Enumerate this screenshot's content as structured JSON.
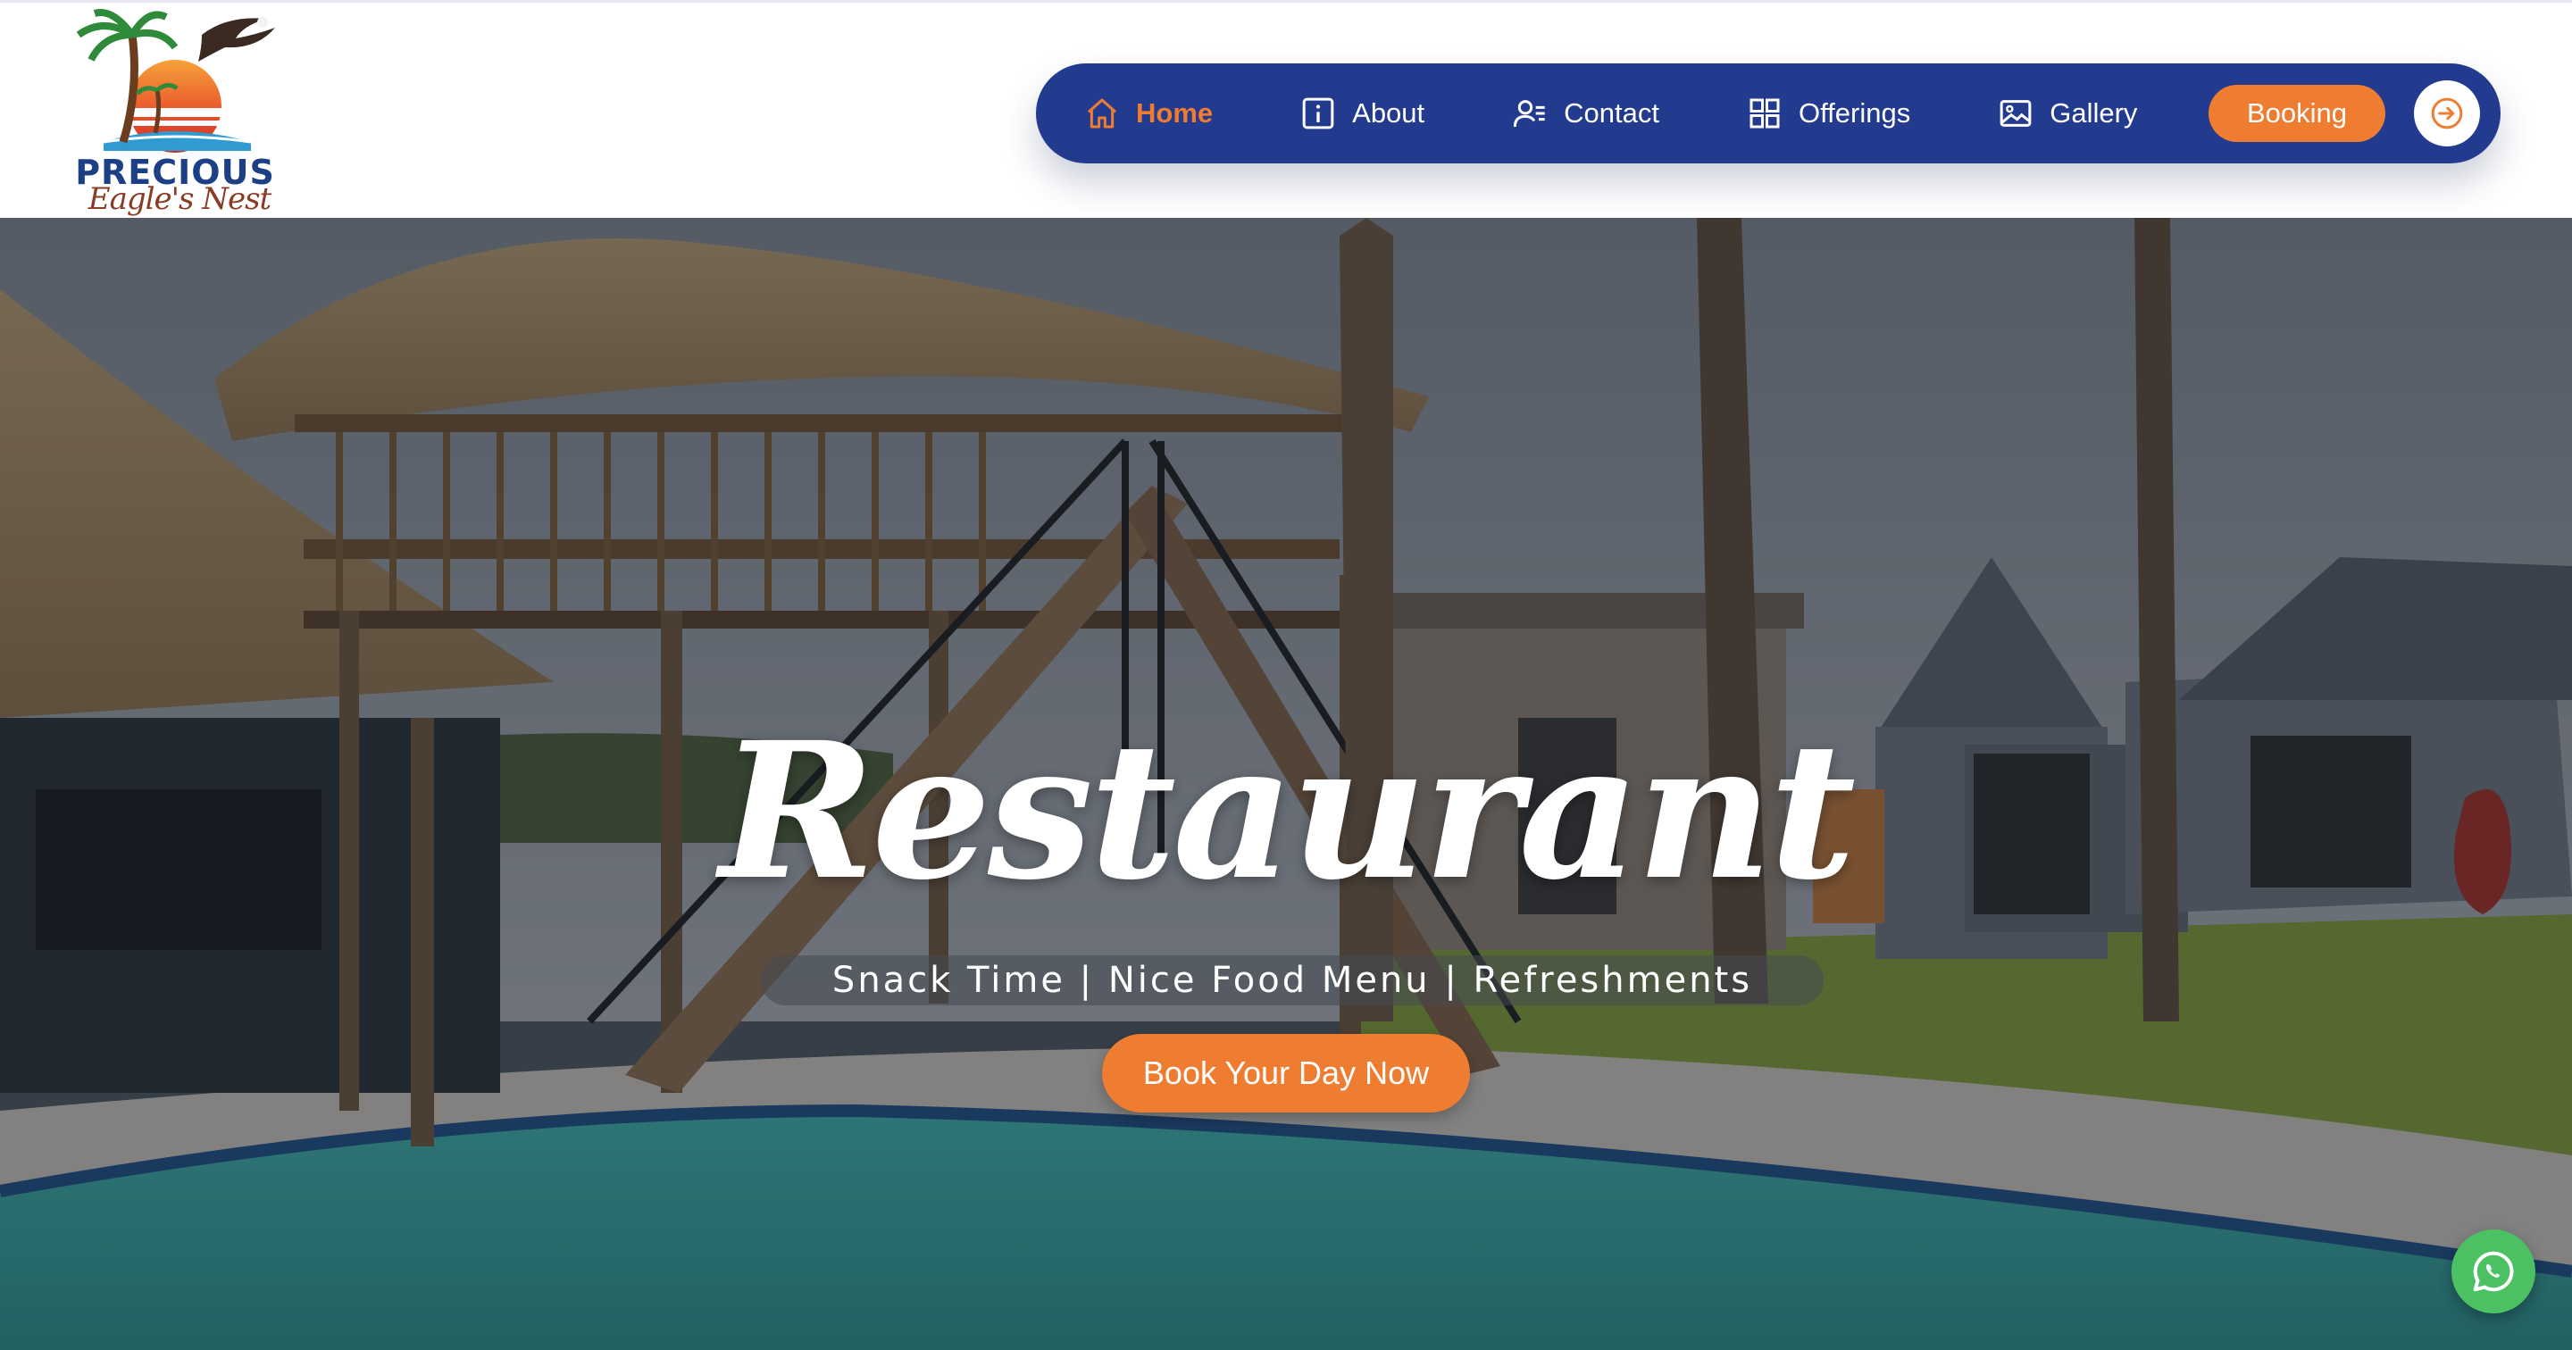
{
  "brand": {
    "name": "PRECIOUS",
    "tagline": "Eagle's Nest",
    "logo_icon": "palm-sunset-eagle-logo"
  },
  "nav": {
    "items": [
      {
        "label": "Home",
        "icon": "home-icon",
        "active": true
      },
      {
        "label": "About",
        "icon": "info-icon",
        "active": false
      },
      {
        "label": "Contact",
        "icon": "contact-icon",
        "active": false
      },
      {
        "label": "Offerings",
        "icon": "grid-icon",
        "active": false
      },
      {
        "label": "Gallery",
        "icon": "image-icon",
        "active": false
      }
    ],
    "booking_label": "Booking",
    "login_icon": "login-icon"
  },
  "hero": {
    "title": "Restaurant",
    "subtitle": "Snack Time | Nice Food Menu | Refreshments",
    "cta_label": "Book Your Day Now"
  },
  "floating": {
    "whatsapp_icon": "whatsapp-icon"
  },
  "colors": {
    "nav_bg": "#233b8e",
    "accent": "#ef7d31",
    "whatsapp": "#4cc163",
    "logo_blue": "#1d3f86"
  }
}
